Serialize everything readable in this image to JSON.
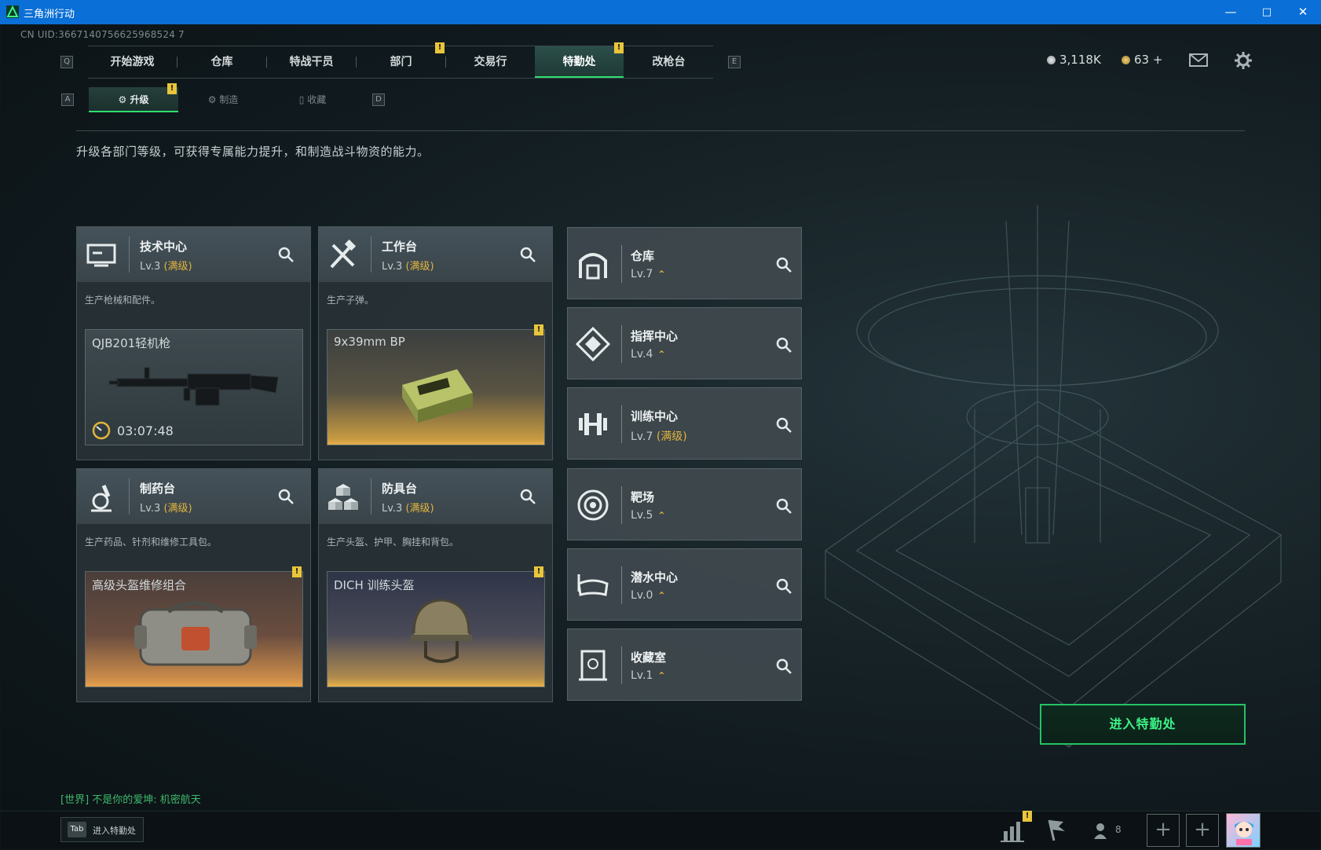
{
  "window": {
    "title": "三角洲行动",
    "controls": [
      "—",
      "□",
      "✕"
    ]
  },
  "uid": "CN UID:3667140756625968524 7",
  "nav": {
    "tabs": [
      {
        "label": "开始游戏"
      },
      {
        "label": "仓库"
      },
      {
        "label": "特战干员"
      },
      {
        "label": "部门"
      },
      {
        "label": "交易行"
      },
      {
        "label": "特勤处",
        "active": true
      },
      {
        "label": "改枪台"
      }
    ],
    "key_left": "Q",
    "key_right": "E"
  },
  "currency": {
    "money": "3,118K",
    "coins": "63",
    "coins_plus": "+"
  },
  "subtabs": {
    "items": [
      {
        "label": "升级",
        "active": true
      },
      {
        "label": "制造"
      },
      {
        "label": "收藏"
      }
    ],
    "key_left": "A",
    "key_right": "D"
  },
  "description": "升级各部门等级，可获得专属能力提升，和制造战斗物资的能力。",
  "cards": [
    {
      "name": "技术中心",
      "level": "Lv.3",
      "status": "(满级)",
      "desc": "生产枪械和配件。",
      "item": "QJB201轻机枪",
      "timer": "03:07:48"
    },
    {
      "name": "工作台",
      "level": "Lv.3",
      "status": "(满级)",
      "desc": "生产子弹。",
      "item": "9x39mm BP"
    },
    {
      "name": "制药台",
      "level": "Lv.3",
      "status": "(满级)",
      "desc": "生产药品、针剂和维修工具包。",
      "item": "高级头盔维修组合"
    },
    {
      "name": "防具台",
      "level": "Lv.3",
      "status": "(满级)",
      "desc": "生产头盔、护甲、胸挂和背包。",
      "item": "DICH 训练头盔"
    }
  ],
  "rooms": [
    {
      "name": "仓库",
      "level": "Lv.7",
      "up": "⌃"
    },
    {
      "name": "指挥中心",
      "level": "Lv.4",
      "up": "⌃"
    },
    {
      "name": "训练中心",
      "level": "Lv.7",
      "status": "(满级)"
    },
    {
      "name": "靶场",
      "level": "Lv.5",
      "up": "⌃"
    },
    {
      "name": "潜水中心",
      "level": "Lv.0",
      "up": "⌃"
    },
    {
      "name": "收藏室",
      "level": "Lv.1",
      "up": "⌃"
    }
  ],
  "enter_button": "进入特勤处",
  "chat": "[世界] 不是你的爱坤: 机密航天",
  "bottom": {
    "tab_key": "Tab",
    "tab_label": "进入特勤处",
    "friends_count": "8",
    "plus": "+"
  },
  "badge": "!",
  "colors": {
    "accent_green": "#2ee06f",
    "gold": "#e2b43e",
    "titlebar": "#0a6fd6"
  }
}
